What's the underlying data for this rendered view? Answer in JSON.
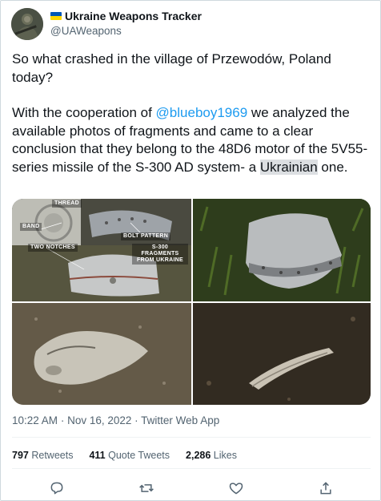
{
  "author": {
    "display_name": "Ukraine Weapons Tracker",
    "handle": "@UAWeapons",
    "flag_colors": [
      "#0057b7",
      "#ffd700"
    ],
    "avatar_icon": "soldier-avatar"
  },
  "tweet": {
    "paragraph1": "So what crashed in the village of Przewodów, Poland today?",
    "p2_pre": "With the cooperation of ",
    "p2_mention": "@blueboy1969",
    "p2_post": " we analyzed the available photos of fragments and came to a clear conclusion that they belong to the 48D6 motor of the 5V55-series missile of the S-300 AD system- a ",
    "p2_highlight": "Ukrainian",
    "p2_end": " one."
  },
  "media": {
    "annotations": {
      "thread": "THREAD",
      "band": "BAND",
      "two_notches": "TWO NOTCHES",
      "bolt_pattern": "BOLT PATTERN",
      "fragments": "S-300 FRAGMENTS FROM UKRAINE"
    }
  },
  "meta": {
    "time": "10:22 AM",
    "date": "Nov 16, 2022",
    "client": "Twitter Web App",
    "separator": "·"
  },
  "stats": {
    "retweets_count": "797",
    "retweets_label": "Retweets",
    "quotes_count": "411",
    "quotes_label": "Quote Tweets",
    "likes_count": "2,286",
    "likes_label": "Likes"
  },
  "actions": [
    "reply-icon",
    "retweet-icon",
    "like-icon",
    "share-icon"
  ],
  "colors": {
    "link": "#1d9bf0",
    "secondary_text": "#536471",
    "primary_text": "#0f1419"
  }
}
